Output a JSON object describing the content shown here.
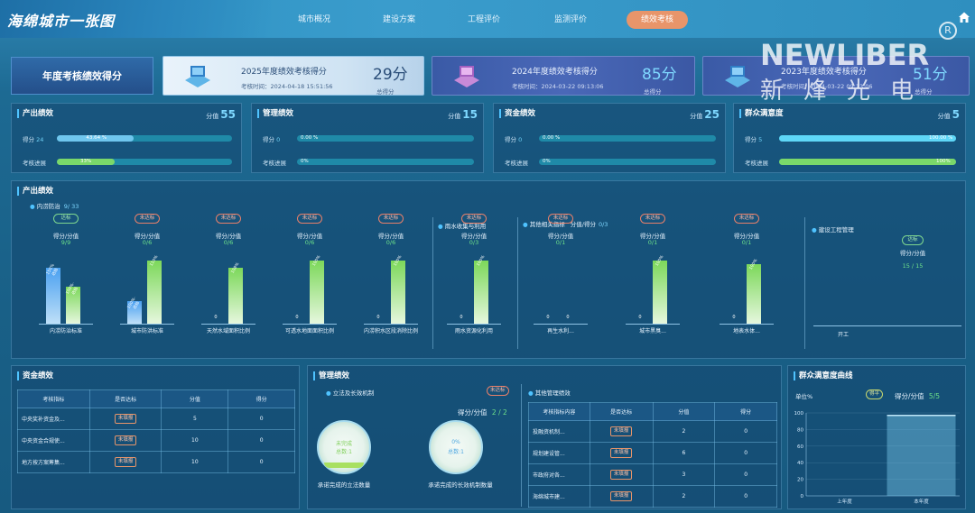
{
  "header": {
    "app_title": "海绵城市一张图",
    "nav": [
      "城市概况",
      "建设方案",
      "工程评价",
      "监测评价",
      "绩效考核"
    ],
    "active_nav": "绩效考核",
    "home_icon": "home-icon"
  },
  "watermark": {
    "brand": "NEWLIBER",
    "cn": "新烽光电",
    "registered": "R"
  },
  "year_label": "年度考核绩效得分",
  "year_cards": [
    {
      "title": "2025年度绩效考核得分",
      "time": "考核时间：2024-04-18 15:51:56",
      "score": "29分",
      "score_label": "总得分"
    },
    {
      "title": "2024年度绩效考核得分",
      "time": "考核时间：2024-03-22 09:13:06",
      "score": "85分",
      "score_label": "总得分"
    },
    {
      "title": "2023年度绩效考核得分",
      "time": "考核时间：2024-03-22 09:13:06",
      "score": "51分",
      "score_label": "总得分"
    }
  ],
  "categories": [
    {
      "title": "产出绩效",
      "score_label": "分值",
      "score": "55",
      "row1_label": "得分",
      "row1_value": "24",
      "row1_pct": 43.64,
      "row1_text": "43.64 %",
      "row2_label": "考核进展",
      "row2_pct": 33,
      "row2_text": "33%"
    },
    {
      "title": "管理绩效",
      "score_label": "分值",
      "score": "15",
      "row1_label": "得分",
      "row1_value": "0",
      "row1_pct": 0,
      "row1_text": "0.00 %",
      "row2_label": "考核进展",
      "row2_pct": 0,
      "row2_text": "0%"
    },
    {
      "title": "资金绩效",
      "score_label": "分值",
      "score": "25",
      "row1_label": "得分",
      "row1_value": "0",
      "row1_pct": 0,
      "row1_text": "0.00 %",
      "row2_label": "考核进展",
      "row2_pct": 0,
      "row2_text": "0%"
    },
    {
      "title": "群众满意度",
      "score_label": "分值",
      "score": "5",
      "row1_label": "得分",
      "row1_value": "5",
      "row1_pct": 100,
      "row1_text": "100.00 %",
      "row2_label": "考核进展",
      "row2_pct": 100,
      "row2_text": "100%"
    }
  ],
  "output": {
    "title": "产出绩效",
    "group1": {
      "label": "内涝防治",
      "count": "9/ 33"
    },
    "group1_items": [
      {
        "badge": "达标",
        "ok": true,
        "label": "得分/分值",
        "value": "9/9",
        "x": "内涝防治标准",
        "bars": [
          15,
          10
        ],
        "bar_labels": [
          "150%达标",
          "100%-达标"
        ]
      },
      {
        "badge": "未达标",
        "ok": false,
        "label": "得分/分值",
        "value": "0/6",
        "x": "城市防洪标准",
        "bars": [
          6,
          17
        ],
        "bar_labels": [
          "100%-达标",
          "110%"
        ]
      },
      {
        "badge": "未达标",
        "ok": false,
        "label": "得分/分值",
        "value": "0/6",
        "x": "天然水域面积比例",
        "bars": [
          0,
          15
        ],
        "bar_labels": [
          "0",
          "108%"
        ]
      },
      {
        "badge": "未达标",
        "ok": false,
        "label": "得分/分值",
        "value": "0/6",
        "x": "可透水地面面积比例",
        "bars": [
          0,
          17
        ],
        "bar_labels": [
          "0",
          "100%"
        ]
      },
      {
        "badge": "未达标",
        "ok": false,
        "label": "得分/分值",
        "value": "0/6",
        "x": "内涝积水区段消除比例",
        "bars": [
          0,
          17
        ],
        "bar_labels": [
          "0",
          "100%"
        ]
      }
    ],
    "group2": {
      "label": "雨水收集与利用"
    },
    "group2_items": [
      {
        "badge": "未达标",
        "ok": false,
        "label": "得分/分值",
        "value": "0/3",
        "x": "雨水资源化利用",
        "bars": [
          0,
          17
        ],
        "bar_labels": [
          "0",
          "100%"
        ]
      }
    ],
    "group3": {
      "label": "其他相关指标",
      "extra": "分值/得分",
      "count": "0/3"
    },
    "group3_items": [
      {
        "badge": "未达标",
        "ok": false,
        "label": "得分/分值",
        "value": "0/1",
        "x": "再生水利...",
        "bars": [
          0,
          0
        ],
        "bar_labels": [
          "0",
          "0"
        ]
      },
      {
        "badge": "未达标",
        "ok": false,
        "label": "得分/分值",
        "value": "0/1",
        "x": "城市黑臭...",
        "bars": [
          0,
          17
        ],
        "bar_labels": [
          "0",
          "100%"
        ]
      },
      {
        "badge": "未达标",
        "ok": false,
        "label": "得分/分值",
        "value": "0/1",
        "x": "地表水体...",
        "bars": [
          0,
          16
        ],
        "bar_labels": [
          "0",
          "100%"
        ]
      }
    ],
    "group4": {
      "label": "建设工程管理"
    },
    "group4_items": [
      {
        "badge": "达标",
        "ok": true,
        "label": "得分/分值",
        "value": "15 / 15",
        "x": "开工"
      }
    ]
  },
  "funding": {
    "title": "资金绩效",
    "headers": [
      "考核指标",
      "是否达标",
      "分值",
      "得分"
    ],
    "rows": [
      {
        "name": "中央奖补资金及...",
        "status": "未填报",
        "score": "5",
        "got": "0"
      },
      {
        "name": "中央资金合规使...",
        "status": "未填报",
        "score": "10",
        "got": "0"
      },
      {
        "name": "地方按方案筹集...",
        "status": "未填报",
        "score": "10",
        "got": "0"
      }
    ]
  },
  "management": {
    "title": "管理绩效",
    "sub1": "立法及长效机制",
    "sub1_badge": "未达标",
    "sub1_score_label": "得分/分值",
    "sub1_score": "2 / 2",
    "circle1": {
      "line1": "未完成",
      "line2": "总数:1",
      "caption": "承诺完成的立法数量"
    },
    "circle2": {
      "line1": "0%",
      "line2": "总数:1",
      "caption": "承诺完成的长效机制数量"
    },
    "sub2": "其他管理绩效",
    "headers": [
      "考核指标内容",
      "是否达标",
      "分值",
      "得分"
    ],
    "rows": [
      {
        "name": "投融资机制...",
        "status": "未填报",
        "score": "2",
        "got": "0"
      },
      {
        "name": "规划建设管...",
        "status": "未填报",
        "score": "6",
        "got": "0"
      },
      {
        "name": "市政府对各...",
        "status": "未填报",
        "score": "3",
        "got": "0"
      },
      {
        "name": "海绵城市建...",
        "status": "未填报",
        "score": "2",
        "got": "0"
      }
    ]
  },
  "satisfaction": {
    "title": "群众满意度曲线",
    "unit": "单位%",
    "badge": "得平",
    "score_label": "得分/分值",
    "score": "5/5",
    "chart_data": {
      "type": "bar",
      "categories": [
        "上年度",
        "本年度"
      ],
      "values": [
        null,
        97
      ],
      "ylim": [
        0,
        100
      ],
      "yticks": [
        "100",
        "80",
        "60",
        "40",
        "20",
        "0"
      ]
    }
  }
}
